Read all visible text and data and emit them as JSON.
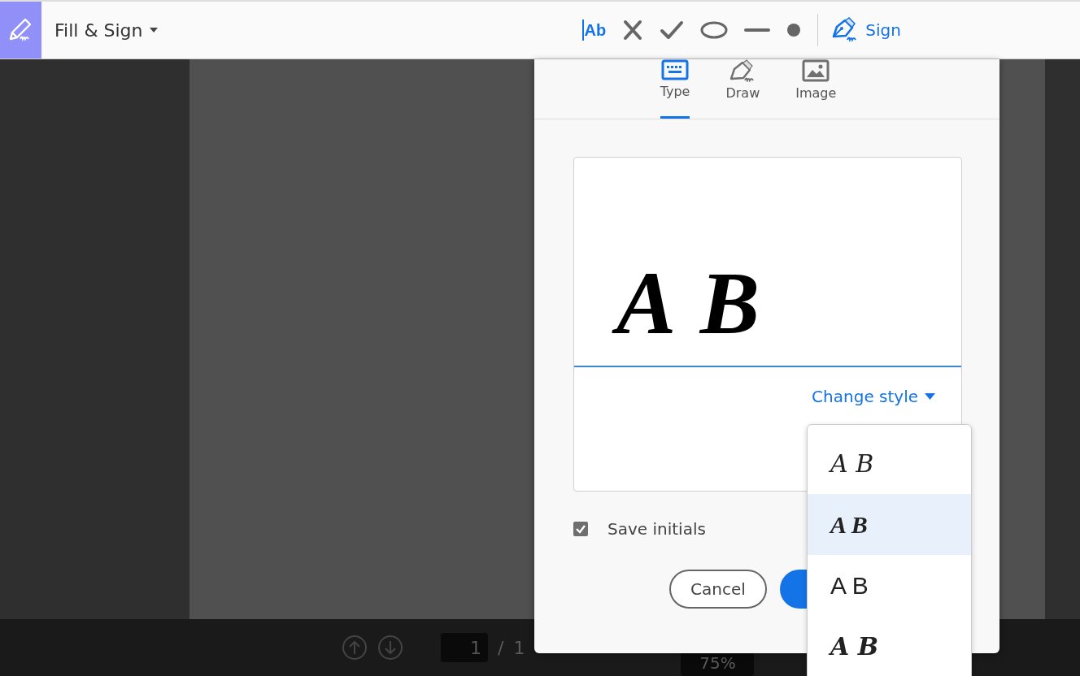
{
  "toolbar": {
    "title": "Fill & Sign",
    "tools": [
      {
        "kind": "text",
        "label": "Ab"
      },
      {
        "kind": "cross"
      },
      {
        "kind": "check"
      },
      {
        "kind": "ellipse"
      },
      {
        "kind": "line"
      },
      {
        "kind": "dot"
      }
    ],
    "sign_label": "Sign"
  },
  "bottom_bar": {
    "page_value": "1",
    "page_separator": "/",
    "page_total": "1",
    "zoom": "75%"
  },
  "dialog": {
    "tabs": [
      {
        "kind": "keyboard",
        "label": "Type",
        "selected": true
      },
      {
        "kind": "pen",
        "label": "Draw",
        "selected": false
      },
      {
        "kind": "image",
        "label": "Image",
        "selected": false
      }
    ],
    "initials": "A B",
    "change_style": "Change style",
    "save_initials": {
      "label": "Save initials",
      "checked": true
    },
    "cancel": "Cancel",
    "styles": [
      {
        "text": "A B",
        "selected": false
      },
      {
        "text": "A B",
        "selected": true
      },
      {
        "text": "A B",
        "selected": false
      },
      {
        "text": "A B",
        "selected": false
      }
    ]
  }
}
